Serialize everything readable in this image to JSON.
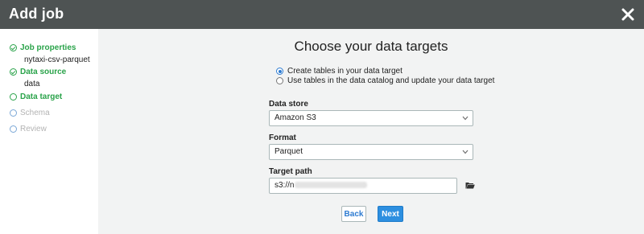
{
  "window": {
    "title": "Add job",
    "close_icon": "close-icon"
  },
  "sidebar": {
    "steps": [
      {
        "label": "Job properties",
        "sub": "nytaxi-csv-parquet",
        "state": "done"
      },
      {
        "label": "Data source",
        "sub": "data",
        "state": "done"
      },
      {
        "label": "Data target",
        "sub": "",
        "state": "active"
      },
      {
        "label": "Schema",
        "sub": "",
        "state": "pending"
      },
      {
        "label": "Review",
        "sub": "",
        "state": "pending"
      }
    ]
  },
  "main": {
    "heading": "Choose your data targets",
    "options": [
      {
        "label": "Create tables in your data target",
        "checked": true
      },
      {
        "label": "Use tables in the data catalog and update your data target",
        "checked": false
      }
    ],
    "data_store": {
      "label": "Data store",
      "value": "Amazon S3"
    },
    "format": {
      "label": "Format",
      "value": "Parquet"
    },
    "target_path": {
      "label": "Target path",
      "value": "s3://n"
    },
    "buttons": {
      "back": "Back",
      "next": "Next"
    }
  },
  "colors": {
    "titlebar": "#4e5353",
    "accent_green": "#2aa34a",
    "primary_blue": "#2d8fe0",
    "panel_bg": "#f2f3f3"
  }
}
